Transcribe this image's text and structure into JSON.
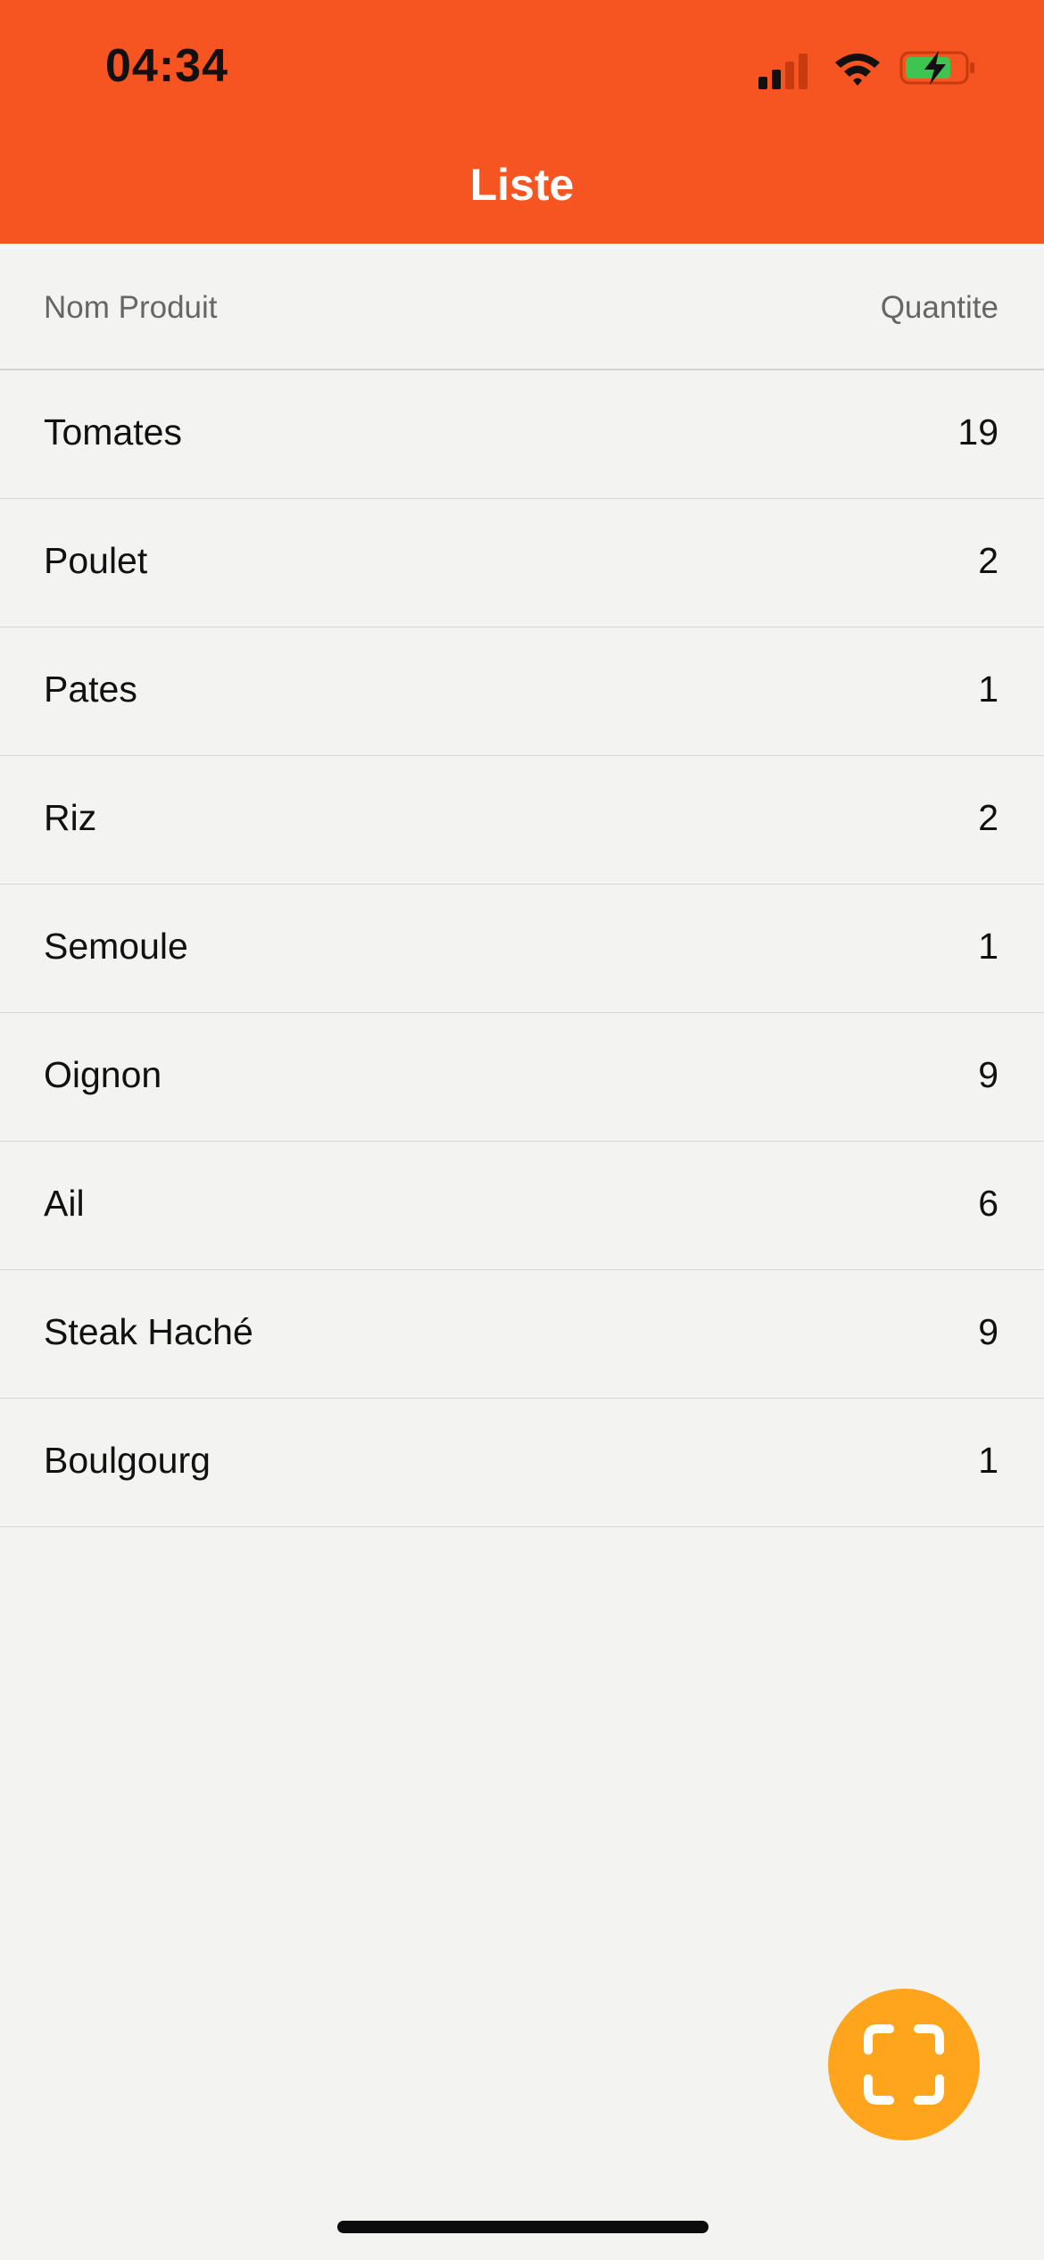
{
  "status_bar": {
    "time": "04:34",
    "signal_icon": "cellular-signal-icon",
    "wifi_icon": "wifi-icon",
    "battery_icon": "battery-charging-icon"
  },
  "nav": {
    "title": "Liste"
  },
  "table": {
    "headers": {
      "name": "Nom Produit",
      "quantity": "Quantite"
    },
    "rows": [
      {
        "name": "Tomates",
        "qty": "19"
      },
      {
        "name": "Poulet",
        "qty": "2"
      },
      {
        "name": "Pates",
        "qty": "1"
      },
      {
        "name": "Riz",
        "qty": "2"
      },
      {
        "name": "Semoule",
        "qty": "1"
      },
      {
        "name": "Oignon",
        "qty": "9"
      },
      {
        "name": "Ail",
        "qty": "6"
      },
      {
        "name": "Steak Haché",
        "qty": "9"
      },
      {
        "name": "Boulgourg",
        "qty": "1"
      }
    ]
  },
  "fab": {
    "icon": "scan-icon"
  },
  "colors": {
    "header": "#f65420",
    "background": "#f3f3f2",
    "fab": "#ffa51d",
    "battery_fill": "#3ec451"
  }
}
